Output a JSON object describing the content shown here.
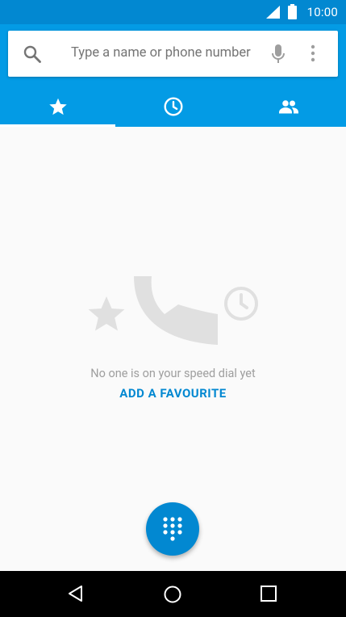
{
  "status_bar": {
    "time": "10:00"
  },
  "search": {
    "placeholder": "Type a name or phone number"
  },
  "tabs": [
    {
      "name": "speed-dial",
      "icon": "star-icon",
      "selected": true
    },
    {
      "name": "recents",
      "icon": "clock-icon",
      "selected": false
    },
    {
      "name": "contacts",
      "icon": "people-icon",
      "selected": false
    }
  ],
  "empty_state": {
    "message": "No one is on your speed dial yet",
    "action": "ADD A FAVOURITE"
  },
  "fab": {
    "icon": "dialpad-icon"
  },
  "colors": {
    "primary": "#039be5",
    "primary_dark": "#0288d1",
    "background": "#fafafa"
  }
}
